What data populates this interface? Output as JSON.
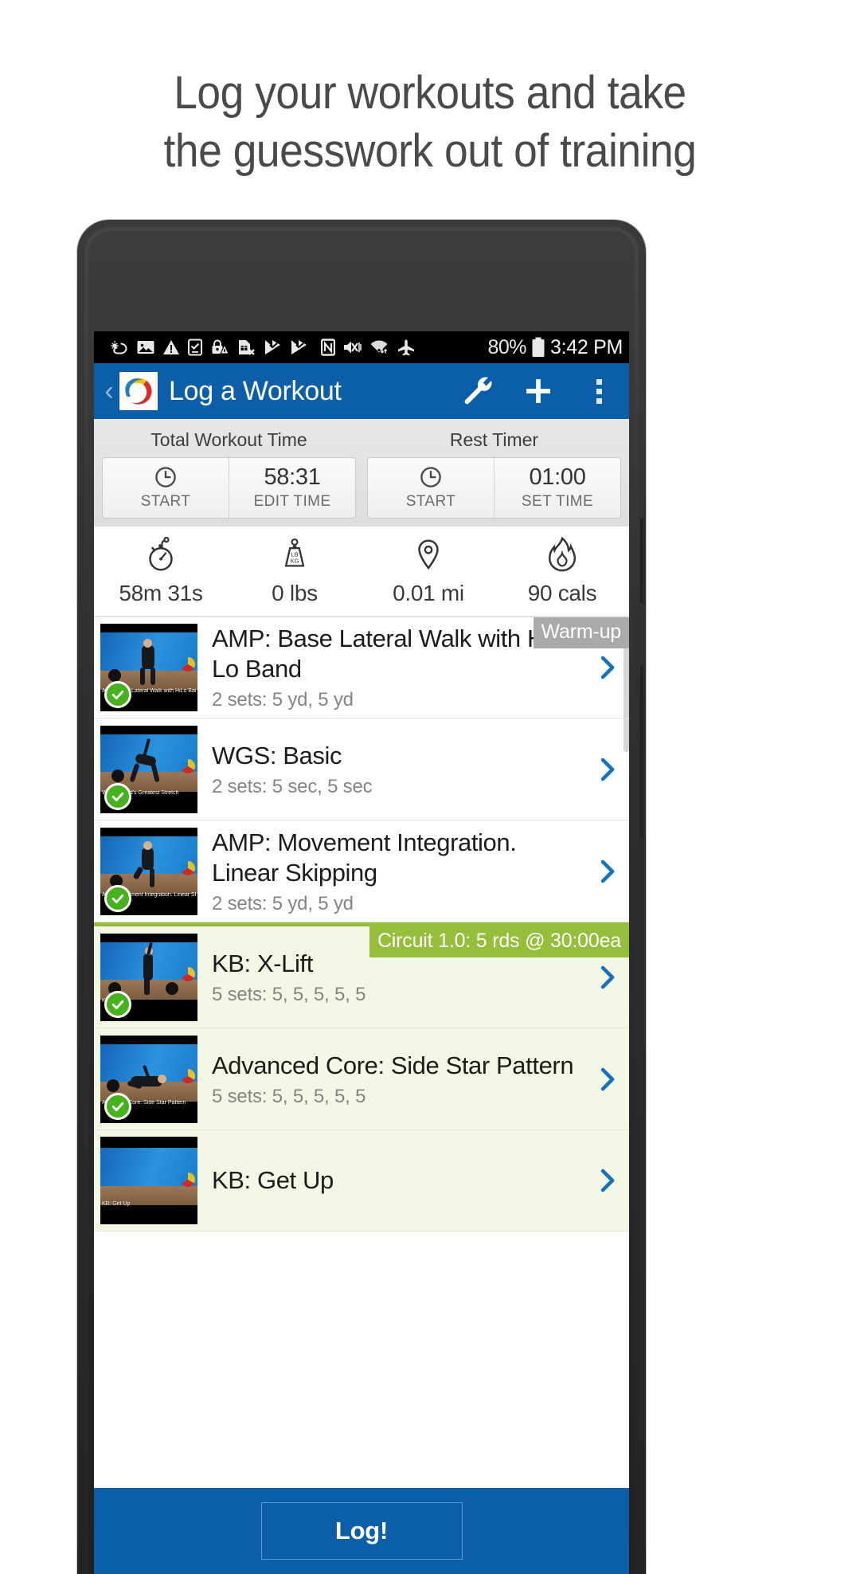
{
  "headline": {
    "line1": "Log your workouts and take",
    "line2": "the guesswork out of training"
  },
  "status_bar": {
    "battery_percent": "80%",
    "time": "3:42 PM",
    "icons": [
      "weather-icon",
      "photo-icon",
      "warning-icon",
      "checkbox-device-icon",
      "lock-warning-icon",
      "sim-removed-icon",
      "flag-check-icon",
      "flag-check-icon-2",
      "nfc-icon",
      "mute-vibrate-icon",
      "wifi-icon",
      "airplane-icon",
      "battery-icon"
    ]
  },
  "app_bar": {
    "back_label": "‹",
    "title": "Log a Workout",
    "actions": [
      "wrench-icon",
      "plus-icon",
      "overflow-icon"
    ],
    "accent_color": "#0b5ea8"
  },
  "timers": {
    "total": {
      "label": "Total Workout Time",
      "start_label": "START",
      "time_value": "58:31",
      "edit_label": "EDIT TIME"
    },
    "rest": {
      "label": "Rest Timer",
      "start_label": "START",
      "time_value": "01:00",
      "edit_label": "SET TIME"
    }
  },
  "stats": [
    {
      "icon": "stopwatch-icon",
      "value": "58m 31s"
    },
    {
      "icon": "weight-icon",
      "value": "0 lbs"
    },
    {
      "icon": "location-pin-icon",
      "value": "0.01 mi"
    },
    {
      "icon": "flame-icon",
      "value": "90 cals"
    }
  ],
  "exercises": [
    {
      "tag": "Warm-up",
      "tag_type": "warm",
      "title": "AMP: Base Lateral Walk with Hi-Lo Band",
      "sets": "2 sets: 5 yd, 5 yd",
      "thumb_caption": "AMP: Base Lateral Walk with HiLo Bands",
      "completed": true,
      "circuit": false
    },
    {
      "tag": "",
      "tag_type": "",
      "title": "WGS: Basic",
      "sets": "2 sets: 5 sec, 5 sec",
      "thumb_caption": "WGS: World's Greatest Stretch",
      "completed": true,
      "circuit": false
    },
    {
      "tag": "",
      "tag_type": "",
      "title": "AMP: Movement Integration. Linear Skipping",
      "sets": "2 sets: 5 yd, 5 yd",
      "thumb_caption": "AMP: Movement Integration. Linear Skipping",
      "completed": true,
      "circuit": false
    },
    {
      "tag": "Circuit 1.0: 5 rds @ 30:00ea",
      "tag_type": "circ",
      "title": "KB: X-Lift",
      "sets": "5 sets: 5, 5, 5, 5, 5",
      "thumb_caption": "KB: X-Lift",
      "completed": true,
      "circuit": true
    },
    {
      "tag": "",
      "tag_type": "",
      "title": "Advanced Core: Side Star Pattern",
      "sets": "5 sets: 5, 5, 5, 5, 5",
      "thumb_caption": "Advanced Core: Side Star Pattern",
      "completed": true,
      "circuit": true
    },
    {
      "tag": "",
      "tag_type": "",
      "title": "KB: Get Up",
      "sets": "",
      "thumb_caption": "KB: Get Up",
      "completed": false,
      "circuit": true
    }
  ],
  "bottom_bar": {
    "log_label": "Log!"
  },
  "colors": {
    "brand_blue": "#0b5ea8",
    "circuit_green": "#95bf3b",
    "circuit_bg": "#f3f8e4",
    "warm_gray": "#a9a9a9",
    "check_green": "#46b21e"
  }
}
